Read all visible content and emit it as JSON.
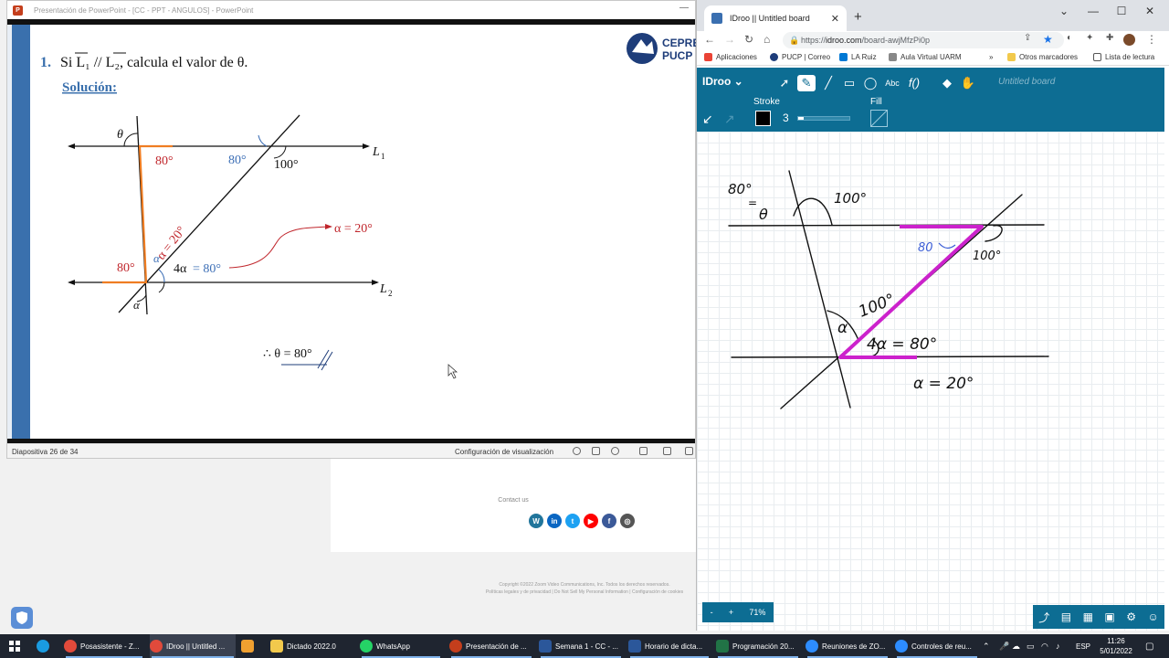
{
  "powerpoint": {
    "window_title": "Presentación de PowerPoint - [CC - PPT - ANGULOS] - PowerPoint",
    "slide": {
      "problem_number": "1.",
      "problem_text": "Si L₁ // L₂, calcula el valor de θ.",
      "solution_label": "Solución:",
      "logo_text_1": "CEPRE",
      "logo_text_2": "PUCP",
      "labels": {
        "theta": "θ",
        "angle_80_red_top": "80°",
        "angle_80_blue": "80°",
        "angle_100": "100°",
        "L1": "L",
        "L1_sub": "1",
        "L2": "L",
        "L2_sub": "2",
        "alpha_eq_20_diag": "α = 20°",
        "alpha_small": "α",
        "alpha_eq_20_callout": "α = 20°",
        "angle_80_red_bottom": "80°",
        "four_alpha": "4α",
        "eq_80": "= 80°",
        "alpha_bottom": "α",
        "answer": "∴ θ = 80°"
      }
    },
    "status": {
      "slide_count": "Diapositiva 26 de 34",
      "view_settings": "Configuración de visualización"
    }
  },
  "zoom_bg": {
    "contact": "Contact us",
    "copyright": "Copyright ©2022 Zoom Video Communications, Inc. Todos los derechos reservados.",
    "links": "Políticas legales y de privacidad | Do Not Sell My Personal Information | Configuración de cookies"
  },
  "chrome": {
    "tab_title": "IDroo || Untitled board",
    "url_prefix": "https://",
    "url_host": "idroo.com",
    "url_path": "/board-awjMfzPi0p",
    "bookmarks": [
      "Aplicaciones",
      "PUCP | Correo",
      "LA Ruiz",
      "Aula Virtual UARM",
      "»",
      "Otros marcadores",
      "Lista de lectura"
    ]
  },
  "idroo": {
    "logo": "IDroo",
    "board_title": "Untitled board",
    "stroke_label": "Stroke",
    "fill_label": "Fill",
    "stroke_width": "3",
    "stroke_color": "#000000",
    "zoom_minus": "-",
    "zoom_plus": "+",
    "zoom_level": "71%",
    "handwriting": {
      "eighty_top": "80°",
      "eq": "=",
      "theta": "θ",
      "hundred_top": "100°",
      "eighty_blue": "80",
      "hundred_right": "100°",
      "hundred_mid": "100°",
      "alpha": "α",
      "four_alpha_eq": "4α = 80°",
      "alpha_eq": "α = 20°"
    }
  },
  "taskbar": {
    "items": [
      "Posasistente - Z...",
      "IDroo || Untitled ...",
      "",
      "Dictado 2022.0",
      "WhatsApp",
      "Presentación de ...",
      "Semana 1 - CC - ...",
      "Horario de dicta...",
      "Programación 20...",
      "Reuniones de ZO...",
      "Controles de reu..."
    ],
    "language": "ESP",
    "time": "11:26",
    "date": "5/01/2022"
  },
  "colors": {
    "ppt_accent": "#3a70ad",
    "idroo_toolbar": "#0d6d93",
    "magenta_stroke": "#cc22cc",
    "orange_line": "#ef7d22",
    "red_label": "#c0262c",
    "blue_label": "#3d6fb6"
  }
}
